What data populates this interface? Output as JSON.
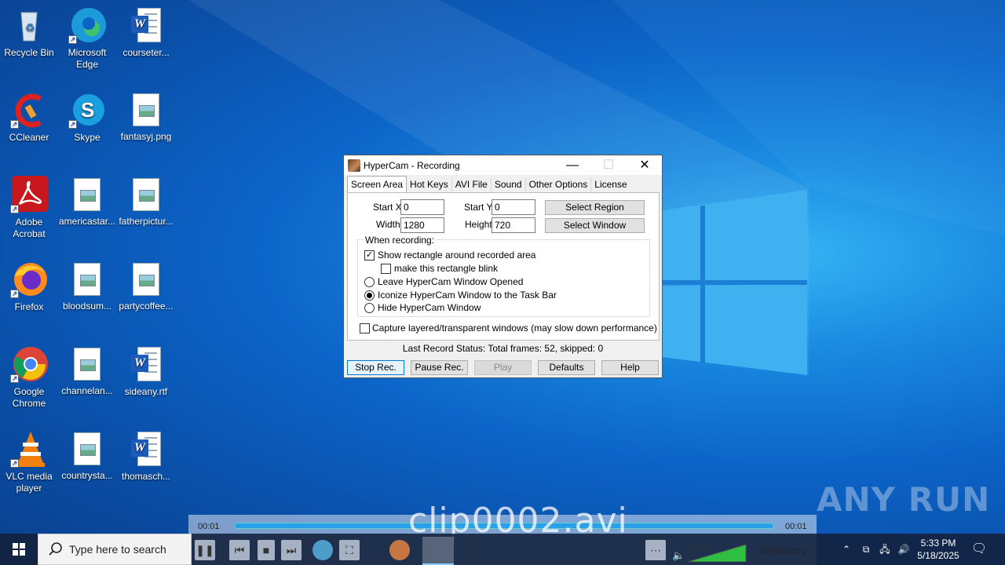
{
  "desktop": {
    "icons": [
      {
        "label": "Recycle Bin"
      },
      {
        "label": "Microsoft Edge"
      },
      {
        "label": "courseter..."
      },
      {
        "label": "CCleaner"
      },
      {
        "label": "Skype"
      },
      {
        "label": "fantasyj.png"
      },
      {
        "label": "Adobe Acrobat"
      },
      {
        "label": "americastar..."
      },
      {
        "label": "fatherpictur..."
      },
      {
        "label": "Firefox"
      },
      {
        "label": "bloodsum..."
      },
      {
        "label": "partycoffee..."
      },
      {
        "label": "Google Chrome"
      },
      {
        "label": "channelan..."
      },
      {
        "label": "sideany.rtf"
      },
      {
        "label": "VLC media player"
      },
      {
        "label": "countrysta..."
      },
      {
        "label": "thomasch..."
      }
    ]
  },
  "hypercam": {
    "title": "HyperCam - Recording",
    "tabs": [
      "Screen Area",
      "Hot Keys",
      "AVI File",
      "Sound",
      "Other Options",
      "License"
    ],
    "start_x_label": "Start X",
    "start_x": "0",
    "start_y_label": "Start Y",
    "start_y": "0",
    "width_label": "Width",
    "width": "1280",
    "height_label": "Height",
    "height": "720",
    "select_region": "Select Region",
    "select_window": "Select Window",
    "when_recording": "When recording:",
    "opt_rectangle": "Show rectangle around recorded area",
    "opt_blink": "make this rectangle blink",
    "opt_leave": "Leave HyperCam Window Opened",
    "opt_iconize": "Iconize HyperCam Window to the Task Bar",
    "opt_hide": "Hide HyperCam Window",
    "opt_layered": "Capture layered/transparent windows (may slow down performance)",
    "status": "Last Record Status: Total frames: 52, skipped: 0",
    "buttons": [
      "Stop Rec.",
      "Pause Rec.",
      "Play",
      "Defaults",
      "Help"
    ]
  },
  "player": {
    "time_start": "00:01",
    "time_end": "00:01",
    "clip_name": "clip0002.avi",
    "volume": "100%",
    "position": "00:01/00:01"
  },
  "watermark": "ANY RUN",
  "taskbar": {
    "search_placeholder": "Type here to search",
    "time": "5:33 PM",
    "date": "5/18/2025"
  }
}
